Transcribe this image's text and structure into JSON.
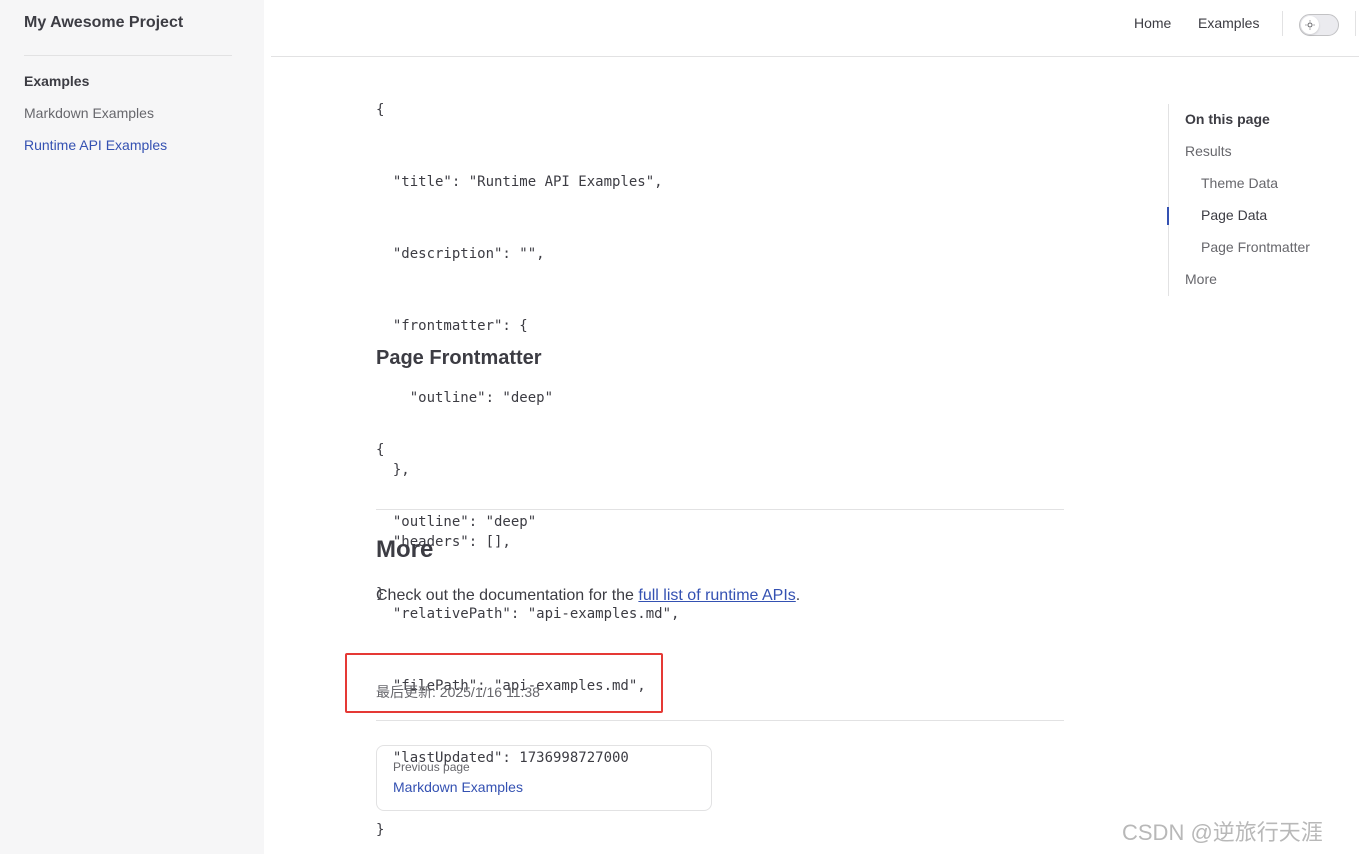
{
  "sidebar": {
    "site_title": "My Awesome Project",
    "group_title": "Examples",
    "items": [
      {
        "label": "Markdown Examples"
      },
      {
        "label": "Runtime API Examples"
      }
    ]
  },
  "nav": {
    "links": [
      {
        "label": "Home"
      },
      {
        "label": "Examples"
      }
    ],
    "theme_toggle_icon": "sun-icon"
  },
  "content": {
    "page_data_code": [
      "{",
      "  \"title\": \"Runtime API Examples\",",
      "  \"description\": \"\",",
      "  \"frontmatter\": {",
      "    \"outline\": \"deep\"",
      "  },",
      "  \"headers\": [],",
      "  \"relativePath\": \"api-examples.md\",",
      "  \"filePath\": \"api-examples.md\",",
      "  \"lastUpdated\": 1736998727000",
      "}"
    ],
    "frontmatter_heading": "Page Frontmatter",
    "frontmatter_code": [
      "{",
      "  \"outline\": \"deep\"",
      "}"
    ],
    "more_heading": "More",
    "more_text_before": "Check out the documentation for the ",
    "more_link": "full list of runtime APIs",
    "more_text_after": ".",
    "last_updated": "最后更新: 2025/1/16 11:38",
    "prev": {
      "desc": "Previous page",
      "title": "Markdown Examples"
    }
  },
  "outline": {
    "title": "On this page",
    "items": [
      {
        "label": "Results"
      },
      {
        "label": "Theme Data"
      },
      {
        "label": "Page Data"
      },
      {
        "label": "Page Frontmatter"
      },
      {
        "label": "More"
      }
    ]
  },
  "watermark": "CSDN @逆旅行天涯",
  "colors": {
    "brand": "#3451b2",
    "sidebar_bg": "#f6f6f7",
    "highlight": "#e53935"
  }
}
